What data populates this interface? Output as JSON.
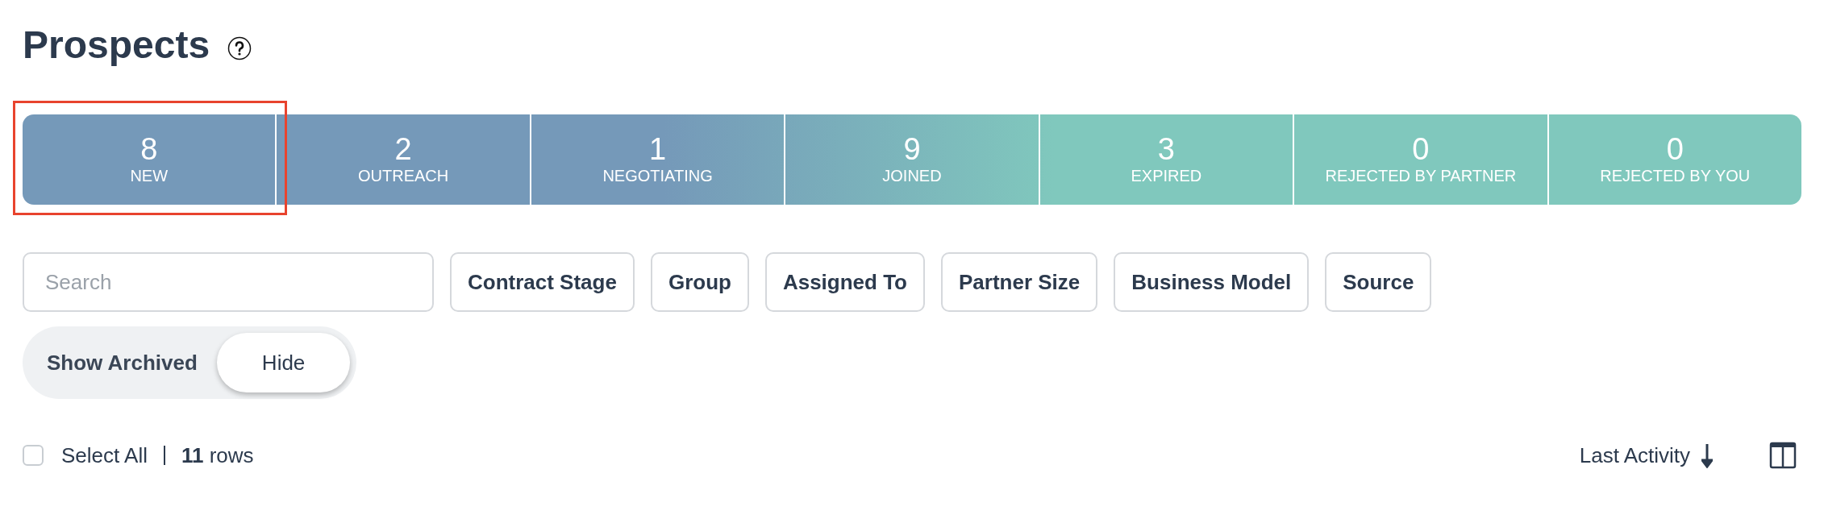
{
  "title": "Prospects",
  "stages": [
    {
      "count": "8",
      "label": "NEW",
      "highlighted": true
    },
    {
      "count": "2",
      "label": "OUTREACH",
      "highlighted": false
    },
    {
      "count": "1",
      "label": "NEGOTIATING",
      "highlighted": false
    },
    {
      "count": "9",
      "label": "JOINED",
      "highlighted": false
    },
    {
      "count": "3",
      "label": "EXPIRED",
      "highlighted": false
    },
    {
      "count": "0",
      "label": "REJECTED BY PARTNER",
      "highlighted": false
    },
    {
      "count": "0",
      "label": "REJECTED BY YOU",
      "highlighted": false
    }
  ],
  "search": {
    "placeholder": "Search"
  },
  "filters": [
    "Contract Stage",
    "Group",
    "Assigned To",
    "Partner Size",
    "Business Model",
    "Source"
  ],
  "archived_toggle": {
    "label": "Show Archived",
    "value": "Hide"
  },
  "list_header": {
    "select_all": {
      "label": "Select All",
      "checked": false
    },
    "row_count": "**11** rows",
    "sort": {
      "label": "Last Activity"
    }
  }
}
